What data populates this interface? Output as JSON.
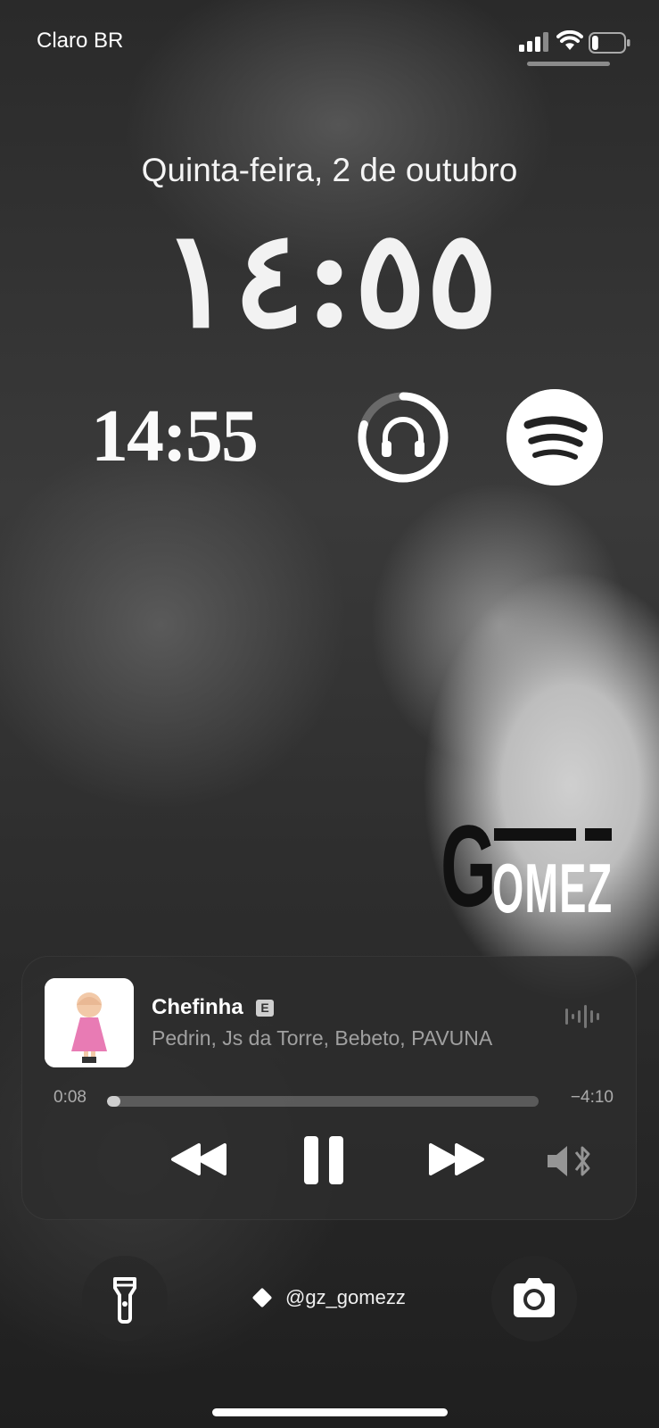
{
  "status_bar": {
    "carrier": "Claro BR",
    "signal_icon": "cellular-signal-icon",
    "wifi_icon": "wifi-icon",
    "battery_icon": "battery-icon",
    "battery_level": 0.2
  },
  "lock_screen": {
    "date": "Quinta-feira, 2 de outubro",
    "time": "١٤:٥٥"
  },
  "widgets": {
    "clock_time": "14:55",
    "headphones_icon": "headphones-icon",
    "headphones_battery": 0.8,
    "spotify_icon": "spotify-icon"
  },
  "wallpaper_logo": {
    "first_letter": "G",
    "rest": "OMEZ"
  },
  "now_playing": {
    "title": "Chefinha",
    "explicit_badge": "E",
    "artists": "Pedrin, Js da Torre, Bebeto, PAVUNA",
    "elapsed": "0:08",
    "remaining": "−4:10",
    "progress": 0.03,
    "controls": {
      "previous_icon": "rewind-icon",
      "pause_icon": "pause-icon",
      "next_icon": "fast-forward-icon",
      "output_icon": "speaker-bluetooth-icon",
      "audio_icon": "waveform-icon"
    }
  },
  "bottom": {
    "flashlight_icon": "flashlight-icon",
    "camera_icon": "camera-icon",
    "handle": "@gz_gomezz"
  }
}
